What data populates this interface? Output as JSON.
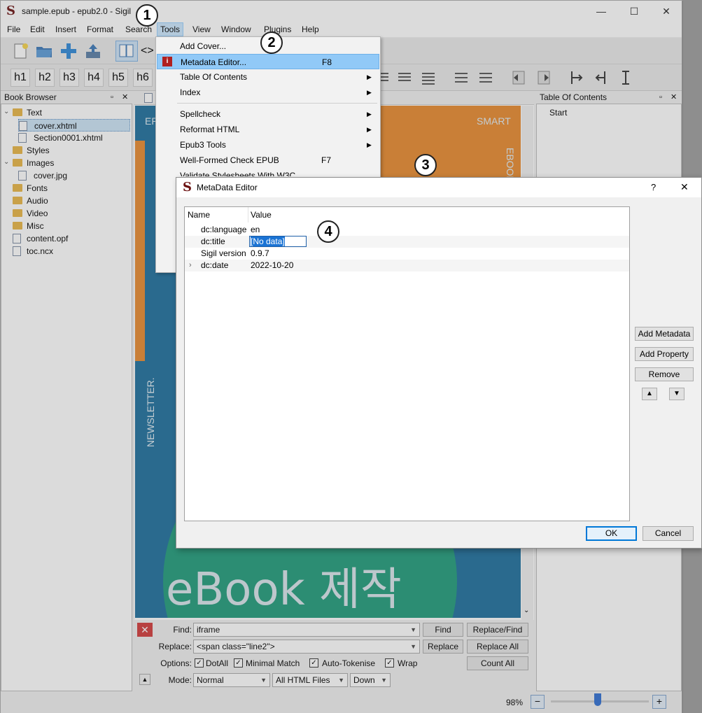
{
  "window": {
    "title": "sample.epub - epub2.0 - Sigil"
  },
  "menubar": [
    "File",
    "Edit",
    "Insert",
    "Format",
    "Search",
    "Tools",
    "View",
    "Window",
    "Plugins",
    "Help"
  ],
  "headings": [
    "h1",
    "h2",
    "h3",
    "h4",
    "h5",
    "h6"
  ],
  "book_browser": {
    "title": "Book Browser",
    "items": [
      "Text",
      "cover.xhtml",
      "Section0001.xhtml",
      "Styles",
      "Images",
      "cover.jpg",
      "Fonts",
      "Audio",
      "Video",
      "Misc",
      "content.opf",
      "toc.ncx"
    ]
  },
  "toc_panel": {
    "title": "Table Of Contents",
    "items": [
      "Start"
    ]
  },
  "cover": {
    "top_left": "EP",
    "smart": "SMART",
    "ebook_vertical": "EBOOK.",
    "newsletter": "NEWSLETTER.",
    "big_text": "eBook 제작"
  },
  "tools_menu": {
    "items": [
      {
        "label": "Add Cover...",
        "shortcut": ""
      },
      {
        "label": "Metadata Editor...",
        "shortcut": "F8"
      },
      {
        "label": "Table Of Contents",
        "shortcut": ""
      },
      {
        "label": "Index",
        "shortcut": ""
      },
      {
        "label": "Spellcheck",
        "shortcut": ""
      },
      {
        "label": "Reformat HTML",
        "shortcut": ""
      },
      {
        "label": "Epub3 Tools",
        "shortcut": ""
      },
      {
        "label": "Well-Formed Check EPUB",
        "shortcut": "F7"
      },
      {
        "label": "Validate Stylesheets With W3C",
        "shortcut": ""
      }
    ]
  },
  "callouts": [
    "1",
    "2",
    "3",
    "4"
  ],
  "dialog": {
    "title": "MetaData Editor",
    "help": "?",
    "columns": [
      "Name",
      "Value"
    ],
    "rows": [
      {
        "name": "dc:language",
        "value": "en"
      },
      {
        "name": "dc:title",
        "value": "[No data]"
      },
      {
        "name": "Sigil version",
        "value": "0.9.7"
      },
      {
        "name": "dc:date",
        "value": "2022-10-20"
      }
    ],
    "buttons": {
      "add_metadata": "Add Metadata",
      "add_property": "Add Property",
      "remove": "Remove",
      "ok": "OK",
      "cancel": "Cancel"
    }
  },
  "findbar": {
    "find_label": "Find:",
    "find_value": "iframe",
    "replace_label": "Replace:",
    "replace_value": "<span class=\"line2\">",
    "options_label": "Options:",
    "options": [
      "DotAll",
      "Minimal Match",
      "Auto-Tokenise",
      "Wrap"
    ],
    "mode_label": "Mode:",
    "mode": "Normal",
    "scope": "All HTML Files",
    "direction": "Down",
    "buttons": {
      "find": "Find",
      "replace_find": "Replace/Find",
      "replace": "Replace",
      "replace_all": "Replace All",
      "count_all": "Count All"
    }
  },
  "status": {
    "zoom": "98%"
  }
}
